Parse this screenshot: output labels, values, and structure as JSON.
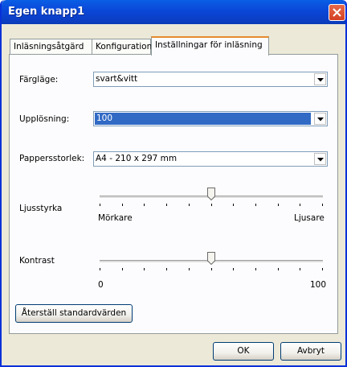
{
  "window": {
    "title": "Egen knapp1"
  },
  "tabs": [
    {
      "label": "Inläsningsåtgärd"
    },
    {
      "label": "Konfiguration"
    },
    {
      "label": "Inställningar för inläsning"
    }
  ],
  "fields": {
    "color_mode": {
      "label": "Färgläge:",
      "value": "svart&vitt"
    },
    "resolution": {
      "label": "Upplösning:",
      "value": "100"
    },
    "paper_size": {
      "label": "Pappersstorlek:",
      "value": "A4 - 210 x 297 mm"
    }
  },
  "brightness": {
    "label": "Ljusstyrka",
    "min_label": "Mörkare",
    "max_label": "Ljusare",
    "level_percent": 50
  },
  "contrast": {
    "label": "Kontrast",
    "min_label": "0",
    "max_label": "100",
    "value": 50
  },
  "buttons": {
    "reset": "Återställ standardvärden",
    "ok": "OK",
    "cancel": "Avbryt"
  },
  "colors": {
    "titlebar": "#0a47d8",
    "selection": "#316ac5",
    "tab_highlight": "#e68b2c",
    "dialog_bg": "#ece9d8"
  }
}
